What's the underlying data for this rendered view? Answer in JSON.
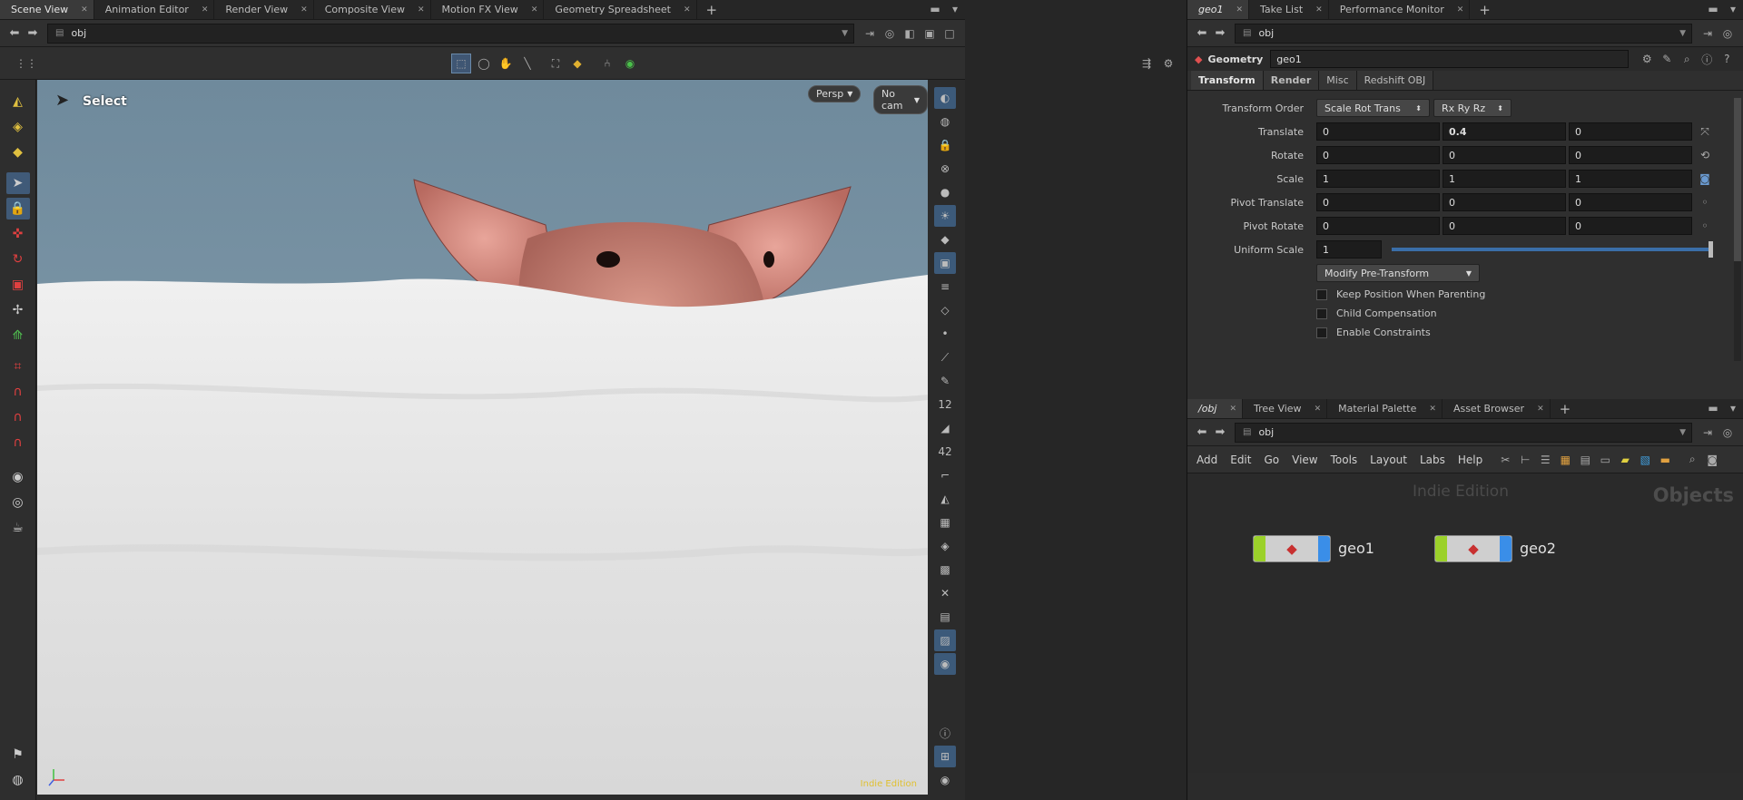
{
  "left_tabs": [
    {
      "label": "Scene View",
      "active": true
    },
    {
      "label": "Animation Editor",
      "active": false
    },
    {
      "label": "Render View",
      "active": false
    },
    {
      "label": "Composite View",
      "active": false
    },
    {
      "label": "Motion FX View",
      "active": false
    },
    {
      "label": "Geometry Spreadsheet",
      "active": false
    }
  ],
  "left_path": "obj",
  "viewport": {
    "tool_label": "Select",
    "persp_label": "Persp",
    "cam_label": "No cam",
    "edition_watermark": "Indie Edition"
  },
  "right_tabs": [
    {
      "label": "geo1",
      "active": true
    },
    {
      "label": "Take List",
      "active": false
    },
    {
      "label": "Performance Monitor",
      "active": false
    }
  ],
  "param_path": "obj",
  "node_header": {
    "type_label": "Geometry",
    "name": "geo1"
  },
  "param_tabs": [
    "Transform",
    "Render",
    "Misc",
    "Redshift OBJ"
  ],
  "params": {
    "transform_order": {
      "label": "Transform Order",
      "value": "Scale Rot Trans",
      "rot_value": "Rx Ry Rz"
    },
    "translate": {
      "label": "Translate",
      "values": [
        "0",
        "0.4",
        "0"
      ]
    },
    "rotate": {
      "label": "Rotate",
      "values": [
        "0",
        "0",
        "0"
      ]
    },
    "scale": {
      "label": "Scale",
      "values": [
        "1",
        "1",
        "1"
      ]
    },
    "pivot_translate": {
      "label": "Pivot Translate",
      "values": [
        "0",
        "0",
        "0"
      ]
    },
    "pivot_rotate": {
      "label": "Pivot Rotate",
      "values": [
        "0",
        "0",
        "0"
      ]
    },
    "uniform_scale": {
      "label": "Uniform Scale",
      "value": "1",
      "slider_fraction": 1.0
    },
    "modify_button": "Modify Pre-Transform",
    "checkboxes": [
      {
        "label": "Keep Position When Parenting",
        "checked": false
      },
      {
        "label": "Child Compensation",
        "checked": false
      },
      {
        "label": "Enable Constraints",
        "checked": false
      }
    ]
  },
  "network_tabs": [
    {
      "label": "/obj",
      "active": true
    },
    {
      "label": "Tree View",
      "active": false
    },
    {
      "label": "Material Palette",
      "active": false
    },
    {
      "label": "Asset Browser",
      "active": false
    }
  ],
  "network_path": "obj",
  "network_menu": [
    "Add",
    "Edit",
    "Go",
    "View",
    "Tools",
    "Layout",
    "Labs",
    "Help"
  ],
  "network": {
    "watermark": "Indie Edition",
    "context_label": "Objects",
    "nodes": [
      {
        "name": "geo1"
      },
      {
        "name": "geo2"
      }
    ]
  },
  "colors": {
    "sky": "#7a95a6",
    "snow": "#e8e8e8",
    "pig": "#c98676",
    "node_green": "#9bd12a",
    "node_blue": "#3a8ee8",
    "indie_yellow": "#e0c030"
  }
}
